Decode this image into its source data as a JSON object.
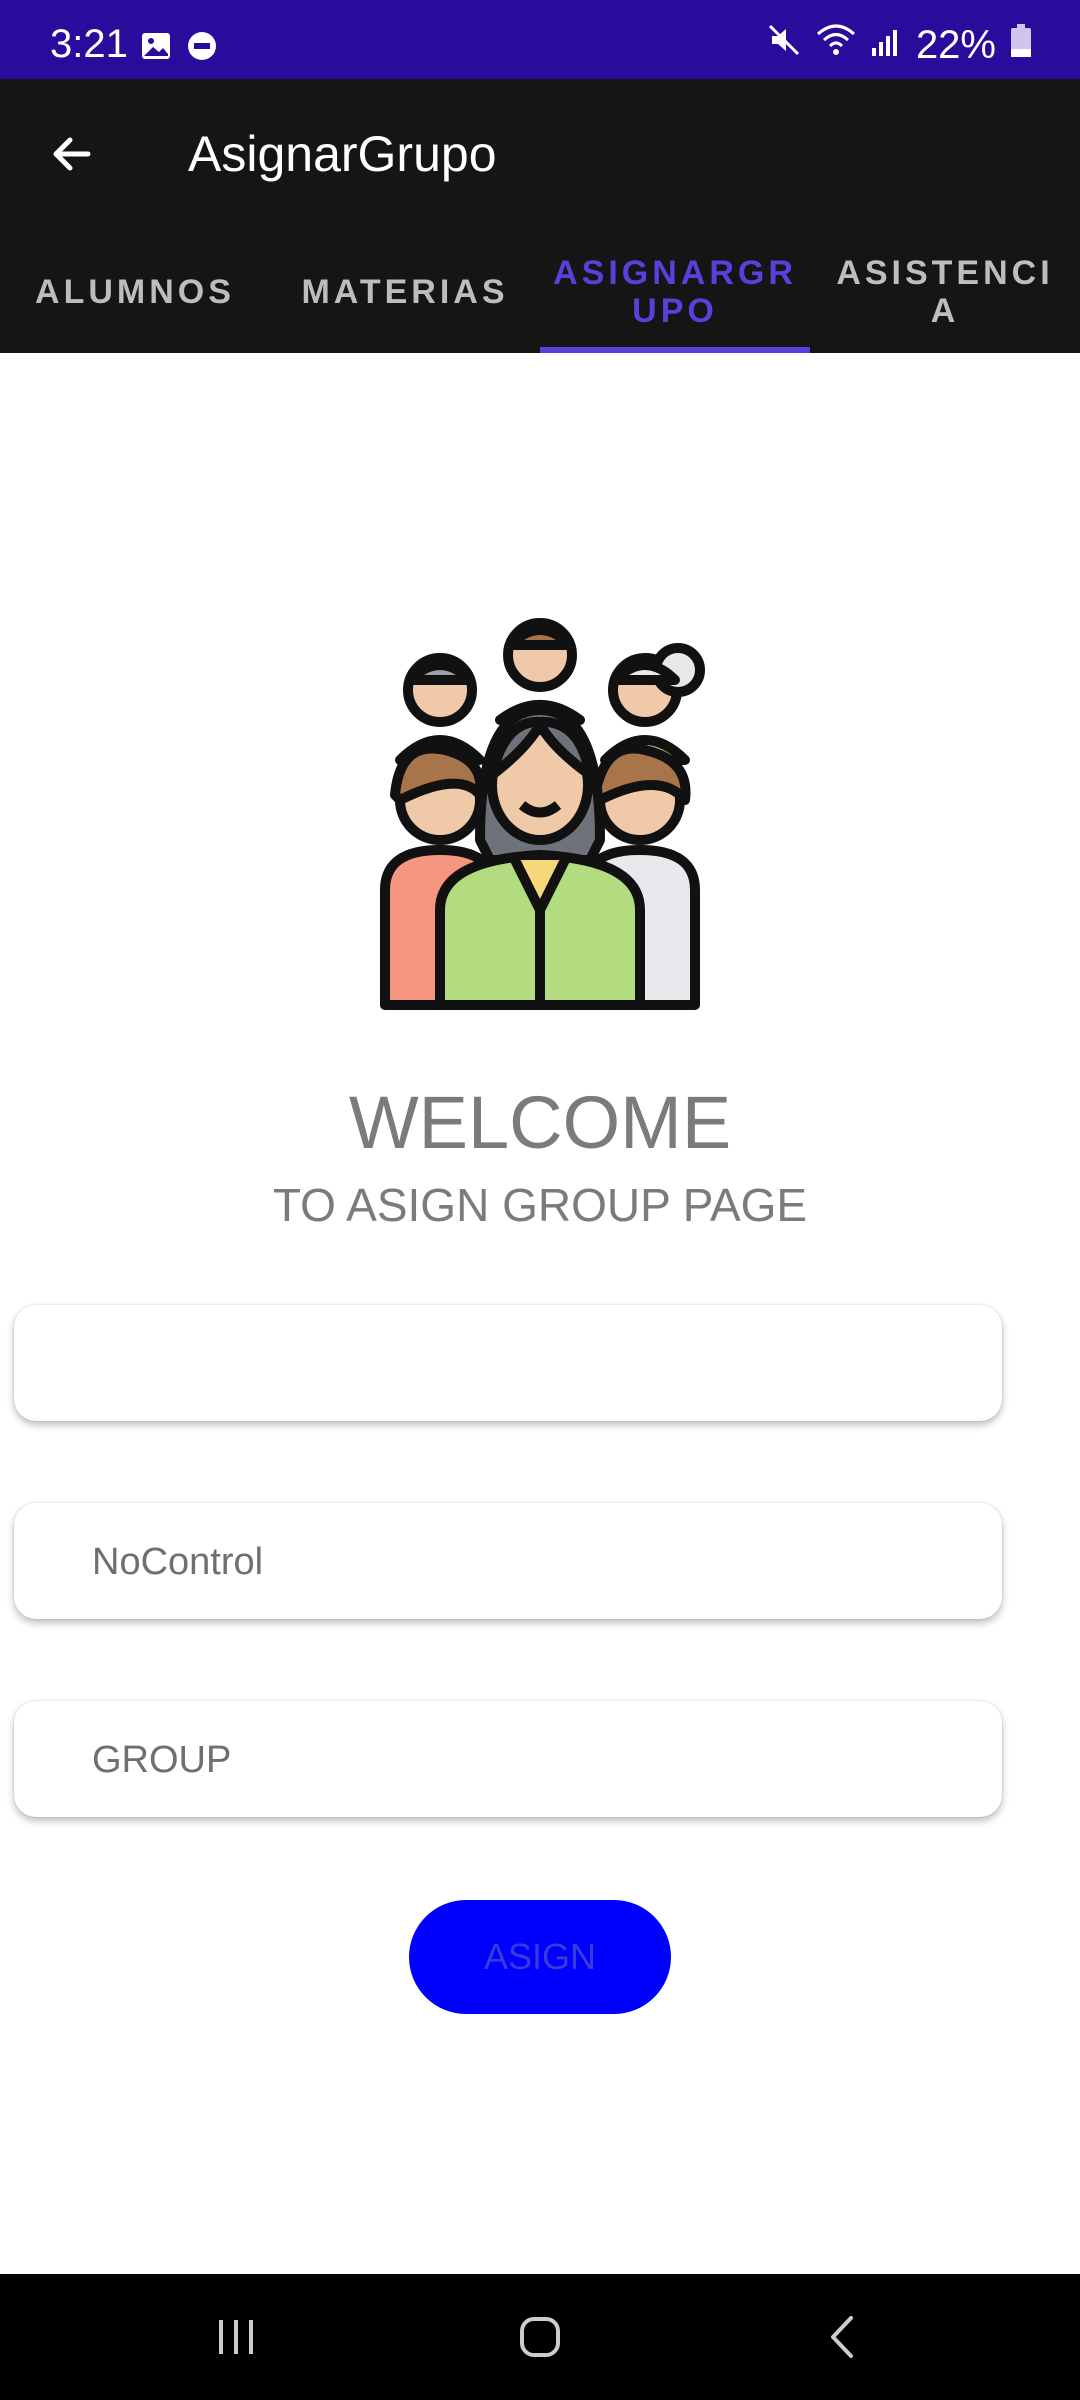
{
  "status_bar": {
    "time": "3:21",
    "battery": "22%",
    "icons_left": [
      "image-icon",
      "dnd-icon"
    ],
    "icons_right": [
      "mute-icon",
      "wifi-icon",
      "signal-icon",
      "battery-icon"
    ]
  },
  "toolbar": {
    "title": "AsignarGrupo",
    "back_icon": "arrow-left-icon"
  },
  "tabs": [
    {
      "label": "ALUMNOS",
      "active": false
    },
    {
      "label": "MATERIAS",
      "active": false
    },
    {
      "label": "ASIGNARGR\nUPO",
      "active": true
    },
    {
      "label": "ASISTENCI\nA",
      "active": false
    }
  ],
  "hero": {
    "icon": "group-people-icon"
  },
  "welcome": {
    "title": "WELCOME",
    "subtitle": "TO ASIGN GROUP PAGE"
  },
  "form": {
    "field1_value": "",
    "field1_placeholder": "",
    "nocontrol_placeholder": "NoControl",
    "group_placeholder": "GROUP",
    "assign_label": "ASIGN"
  },
  "colors": {
    "status_bar": "#2a0c9c",
    "toolbar": "#151515",
    "accent": "#5a3fdc",
    "button": "#0000ff"
  },
  "nav_bar": {
    "icons": [
      "recents-icon",
      "home-icon",
      "back-icon"
    ]
  }
}
